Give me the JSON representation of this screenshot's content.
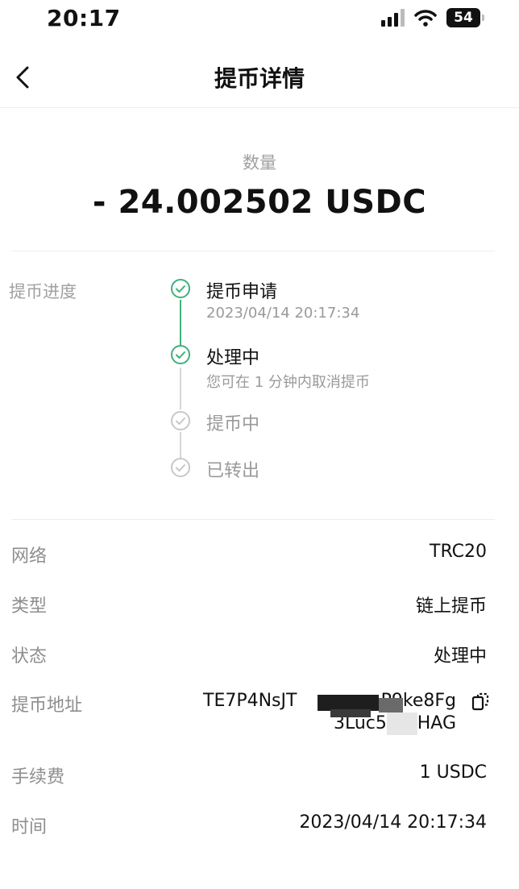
{
  "status_bar": {
    "time": "20:17",
    "battery": "54"
  },
  "nav": {
    "title": "提币详情"
  },
  "amount": {
    "label": "数量",
    "value": "- 24.002502 USDC"
  },
  "progress": {
    "label": "提币进度",
    "steps": [
      {
        "title": "提币申请",
        "subtitle": "2023/04/14 20:17:34",
        "state": "done"
      },
      {
        "title": "处理中",
        "subtitle": "您可在 1 分钟内取消提币",
        "state": "done"
      },
      {
        "title": "提币中",
        "state": "pending"
      },
      {
        "title": "已转出",
        "state": "pending"
      }
    ]
  },
  "details": {
    "network": {
      "label": "网络",
      "value": "TRC20"
    },
    "type": {
      "label": "类型",
      "value": "链上提币"
    },
    "status": {
      "label": "状态",
      "value": "处理中"
    },
    "address": {
      "label": "提币地址",
      "line1_start": "TE7P4NsJT",
      "line1_end": "P9ke8Fg",
      "line2_start": "3Luc5",
      "line2_end": "HAG"
    },
    "fee": {
      "label": "手续费",
      "value": "1 USDC"
    },
    "time": {
      "label": "时间",
      "value": "2023/04/14 20:17:34"
    }
  },
  "colors": {
    "accent_green": "#3fb07a",
    "pending_gray": "#c8c8c8"
  }
}
